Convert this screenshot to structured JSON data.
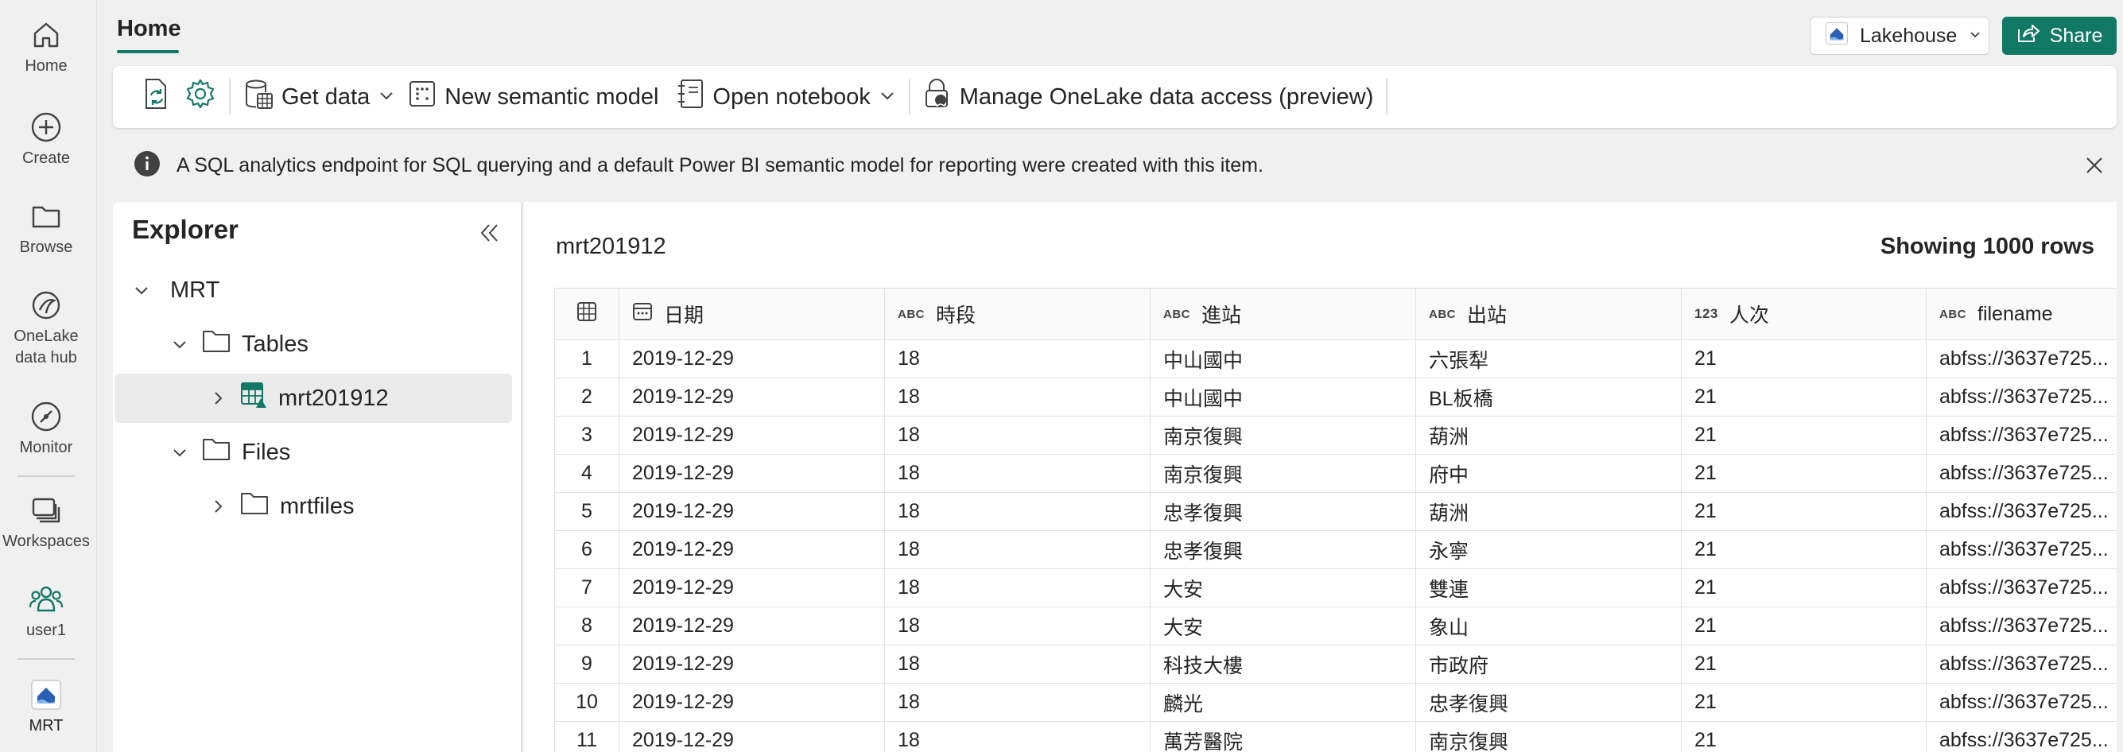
{
  "rail": {
    "items": [
      {
        "label": "Home",
        "icon": "home-icon"
      },
      {
        "label": "Create",
        "icon": "plus-circle-icon"
      },
      {
        "label": "Browse",
        "icon": "folder-icon"
      },
      {
        "label": "OneLake\ndata hub",
        "label1": "OneLake",
        "label2": "data hub",
        "icon": "onelake-icon"
      },
      {
        "label": "Monitor",
        "icon": "monitor-icon"
      },
      {
        "label": "Workspaces",
        "icon": "workspaces-icon"
      },
      {
        "label": "user1",
        "icon": "user-group-icon"
      },
      {
        "label": "MRT",
        "icon": "lakehouse-icon"
      }
    ]
  },
  "header": {
    "tab": "Home",
    "lakehouse_label": "Lakehouse",
    "share_label": "Share"
  },
  "ribbon": {
    "get_data": "Get data",
    "new_semantic_model": "New semantic model",
    "open_notebook": "Open notebook",
    "manage_access": "Manage OneLake data access (preview)"
  },
  "info": {
    "message": "A SQL analytics endpoint for SQL querying and a default Power BI semantic model for reporting were created with this item."
  },
  "explorer": {
    "title": "Explorer",
    "root": "MRT",
    "tables_label": "Tables",
    "table_item": "mrt201912",
    "files_label": "Files",
    "files_item": "mrtfiles"
  },
  "table": {
    "name": "mrt201912",
    "row_count_text": "Showing 1000 rows",
    "columns": [
      {
        "type": "date",
        "name": "日期"
      },
      {
        "type": "ABC",
        "name": "時段"
      },
      {
        "type": "ABC",
        "name": "進站"
      },
      {
        "type": "ABC",
        "name": "出站"
      },
      {
        "type": "123",
        "name": "人次"
      },
      {
        "type": "ABC",
        "name": "filename"
      }
    ],
    "rows": [
      {
        "n": "1",
        "c": [
          "2019-12-29",
          "18",
          "中山國中",
          "六張犁",
          "21",
          "abfss://3637e725..."
        ]
      },
      {
        "n": "2",
        "c": [
          "2019-12-29",
          "18",
          "中山國中",
          "BL板橋",
          "21",
          "abfss://3637e725..."
        ]
      },
      {
        "n": "3",
        "c": [
          "2019-12-29",
          "18",
          "南京復興",
          "葫洲",
          "21",
          "abfss://3637e725..."
        ]
      },
      {
        "n": "4",
        "c": [
          "2019-12-29",
          "18",
          "南京復興",
          "府中",
          "21",
          "abfss://3637e725..."
        ]
      },
      {
        "n": "5",
        "c": [
          "2019-12-29",
          "18",
          "忠孝復興",
          "葫洲",
          "21",
          "abfss://3637e725..."
        ]
      },
      {
        "n": "6",
        "c": [
          "2019-12-29",
          "18",
          "忠孝復興",
          "永寧",
          "21",
          "abfss://3637e725..."
        ]
      },
      {
        "n": "7",
        "c": [
          "2019-12-29",
          "18",
          "大安",
          "雙連",
          "21",
          "abfss://3637e725..."
        ]
      },
      {
        "n": "8",
        "c": [
          "2019-12-29",
          "18",
          "大安",
          "象山",
          "21",
          "abfss://3637e725..."
        ]
      },
      {
        "n": "9",
        "c": [
          "2019-12-29",
          "18",
          "科技大樓",
          "市政府",
          "21",
          "abfss://3637e725..."
        ]
      },
      {
        "n": "10",
        "c": [
          "2019-12-29",
          "18",
          "麟光",
          "忠孝復興",
          "21",
          "abfss://3637e725..."
        ]
      },
      {
        "n": "11",
        "c": [
          "2019-12-29",
          "18",
          "萬芳醫院",
          "南京復興",
          "21",
          "abfss://3637e725..."
        ]
      }
    ]
  },
  "colors": {
    "accent": "#117865",
    "rail_bg": "#f0f0f0",
    "panel_bg": "#ffffff"
  }
}
